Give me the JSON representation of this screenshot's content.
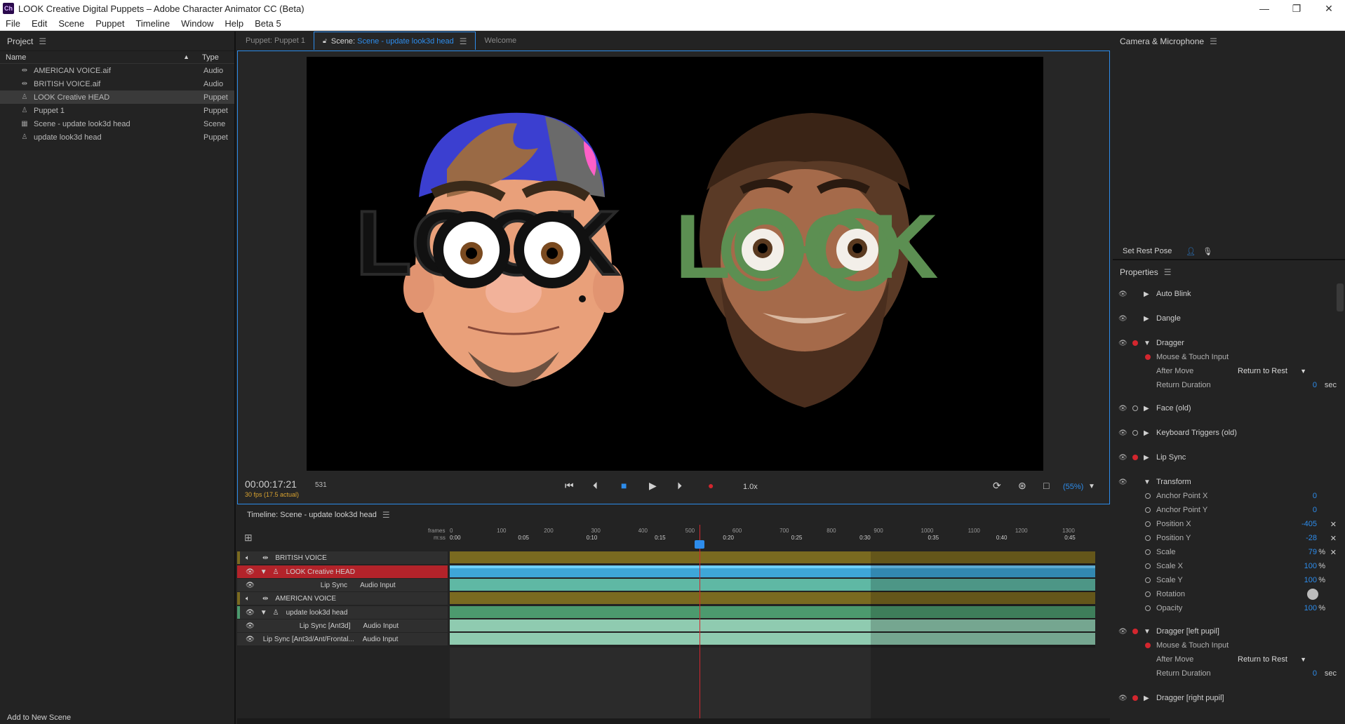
{
  "window": {
    "app_icon": "Ch",
    "title": "LOOK Creative Digital Puppets – Adobe Character Animator CC (Beta)",
    "controls": [
      "—",
      "❐",
      "✕"
    ]
  },
  "menu": [
    "File",
    "Edit",
    "Scene",
    "Puppet",
    "Timeline",
    "Window",
    "Help",
    "Beta 5"
  ],
  "project": {
    "title": "Project",
    "col_name": "Name",
    "col_type": "Type",
    "items": [
      {
        "name": "AMERICAN VOICE.aif",
        "type": "Audio",
        "icon": "audio-icon"
      },
      {
        "name": "BRITISH VOICE.aif",
        "type": "Audio",
        "icon": "audio-icon"
      },
      {
        "name": "LOOK Creative HEAD",
        "type": "Puppet",
        "icon": "puppet-icon"
      },
      {
        "name": "Puppet 1",
        "type": "Puppet",
        "icon": "puppet-icon"
      },
      {
        "name": "Scene - update look3d head",
        "type": "Scene",
        "icon": "scene-icon"
      },
      {
        "name": "update look3d head",
        "type": "Puppet",
        "icon": "puppet-icon"
      }
    ],
    "add_to_scene": "Add to New Scene"
  },
  "scene": {
    "tabs": {
      "puppet": "Puppet: Puppet 1",
      "scene_prefix": "Scene:",
      "scene_name": "Scene - update look3d head",
      "welcome": "Welcome"
    },
    "timecode": "00:00:17:21",
    "frame": "531",
    "fps": "30 fps (17.5 actual)",
    "speed": "1.0x",
    "zoom": "(55%)",
    "stage_text_left": "LOOK",
    "stage_text_right": "LOOK"
  },
  "timeline": {
    "title": "Timeline: Scene - update look3d head",
    "ruler_frames_label": "frames",
    "ruler_time_label": "m:ss",
    "frame_ticks": [
      "0",
      "100",
      "200",
      "300",
      "400",
      "500",
      "600",
      "700",
      "800",
      "900",
      "1000",
      "1100",
      "1200",
      "1300"
    ],
    "time_ticks": [
      "0:00",
      "0:05",
      "0:10",
      "0:15",
      "0:20",
      "0:25",
      "0:30",
      "0:35",
      "0:40",
      "0:45"
    ],
    "tracks": [
      {
        "name": "BRITISH VOICE",
        "sub": ""
      },
      {
        "name": "LOOK Creative HEAD",
        "sub": ""
      },
      {
        "name": "Lip Sync",
        "sub": "Audio Input"
      },
      {
        "name": "AMERICAN VOICE",
        "sub": ""
      },
      {
        "name": "update look3d head",
        "sub": ""
      },
      {
        "name": "Lip Sync [Ant3d]",
        "sub": "Audio Input"
      },
      {
        "name": "Lip Sync [Ant3d/Ant/Frontal...",
        "sub": "Audio Input"
      }
    ]
  },
  "camera": {
    "title": "Camera & Microphone",
    "set_rest_pose": "Set Rest Pose"
  },
  "properties": {
    "title": "Properties",
    "auto_blink": "Auto Blink",
    "dangle": "Dangle",
    "dragger": "Dragger",
    "mouse_touch": "Mouse & Touch Input",
    "after_move": "After Move",
    "after_move_val": "Return to Rest",
    "return_duration": "Return Duration",
    "return_duration_val": "0",
    "sec": "sec",
    "face_old": "Face (old)",
    "keyboard_triggers": "Keyboard Triggers (old)",
    "lip_sync": "Lip Sync",
    "transform": "Transform",
    "anchor_x": "Anchor Point X",
    "anchor_x_val": "0",
    "anchor_y": "Anchor Point Y",
    "anchor_y_val": "0",
    "pos_x": "Position X",
    "pos_x_val": "-405",
    "pos_y": "Position Y",
    "pos_y_val": "-28",
    "scale": "Scale",
    "scale_val": "79",
    "scale_x": "Scale X",
    "scale_x_val": "100",
    "scale_y": "Scale Y",
    "scale_y_val": "100",
    "rotation": "Rotation",
    "opacity": "Opacity",
    "opacity_val": "100",
    "percent": "%",
    "dragger_left": "Dragger [left pupil]",
    "mouse_touch2": "Mouse & Touch Input",
    "after_move2": "After Move",
    "after_move_val2": "Return to Rest",
    "return_duration2": "Return Duration",
    "return_duration_val2": "0",
    "dragger_right": "Dragger [right pupil]"
  },
  "colors": {
    "accent_blue": "#2d8ceb",
    "record_red": "#d3262e",
    "selected_track": "#b3232a",
    "audio_track": "#7a6a20",
    "puppet_track": "#5fb8a4",
    "look_green": "#5c8f52"
  }
}
